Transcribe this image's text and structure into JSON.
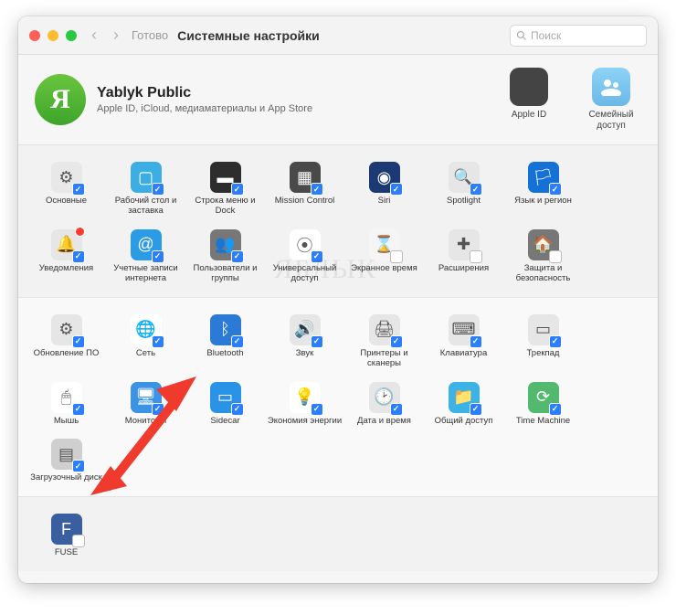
{
  "titlebar": {
    "done": "Готово",
    "title": "Системные настройки",
    "search_placeholder": "Поиск"
  },
  "account": {
    "avatar_letter": "Я",
    "name": "Yablyk Public",
    "subtitle": "Apple ID, iCloud, медиаматериалы и App Store",
    "apple_id": "Apple ID",
    "family": "Семейный доступ"
  },
  "section1": [
    {
      "label": "Основные",
      "icon": "⚙︎",
      "ibg": "#e8e8e8",
      "checked": true
    },
    {
      "label": "Рабочий стол и заставка",
      "icon": "▢",
      "ibg": "#3caee3",
      "checked": true
    },
    {
      "label": "Строка меню и Dock",
      "icon": "▬",
      "ibg": "#2d2d2d",
      "checked": true
    },
    {
      "label": "Mission Control",
      "icon": "▦",
      "ibg": "#4a4a4a",
      "checked": true
    },
    {
      "label": "Siri",
      "icon": "◉",
      "ibg": "#1b3a74",
      "checked": true
    },
    {
      "label": "Spotlight",
      "icon": "🔍",
      "ibg": "#e6e6e6",
      "checked": true
    },
    {
      "label": "Язык и регион",
      "icon": "🏳",
      "ibg": "#1471d6",
      "checked": true
    },
    {
      "label": "Уведомления",
      "icon": "🔔",
      "ibg": "#e6e6e6",
      "checked": true,
      "badge": true
    },
    {
      "label": "Учетные записи интернета",
      "icon": "@",
      "ibg": "#2b9be6",
      "checked": true
    },
    {
      "label": "Пользователи и группы",
      "icon": "👥",
      "ibg": "#777",
      "checked": true
    },
    {
      "label": "Универсальный доступ",
      "icon": "⦿",
      "ibg": "#fff",
      "checked": true
    },
    {
      "label": "Экранное время",
      "icon": "⌛",
      "ibg": "#f5f5f5",
      "checked": false
    },
    {
      "label": "Расширения",
      "icon": "✚",
      "ibg": "#e6e6e6",
      "checked": false
    },
    {
      "label": "Защита и безопасность",
      "icon": "🏠",
      "ibg": "#777",
      "checked": false
    }
  ],
  "section2": [
    {
      "label": "Обновление ПО",
      "icon": "⚙︎",
      "ibg": "#e6e6e6",
      "checked": true
    },
    {
      "label": "Сеть",
      "icon": "🌐",
      "ibg": "#fff",
      "checked": true
    },
    {
      "label": "Bluetooth",
      "icon": "ᛒ",
      "ibg": "#2b7bd6",
      "checked": true
    },
    {
      "label": "Звук",
      "icon": "🔊",
      "ibg": "#e6e6e6",
      "checked": true
    },
    {
      "label": "Принтеры и сканеры",
      "icon": "🖨",
      "ibg": "#e6e6e6",
      "checked": true
    },
    {
      "label": "Клавиатура",
      "icon": "⌨",
      "ibg": "#e6e6e6",
      "checked": true
    },
    {
      "label": "Трекпад",
      "icon": "▭",
      "ibg": "#e6e6e6",
      "checked": true
    },
    {
      "label": "Мышь",
      "icon": "🖱",
      "ibg": "#fff",
      "checked": true
    },
    {
      "label": "Мониторы",
      "icon": "🖥",
      "ibg": "#3b93e6",
      "checked": true
    },
    {
      "label": "Sidecar",
      "icon": "▭",
      "ibg": "#2b93e6",
      "checked": true
    },
    {
      "label": "Экономия энергии",
      "icon": "💡",
      "ibg": "#fff",
      "checked": true
    },
    {
      "label": "Дата и время",
      "icon": "🕑",
      "ibg": "#e6e6e6",
      "checked": true
    },
    {
      "label": "Общий доступ",
      "icon": "📁",
      "ibg": "#3cb3e6",
      "checked": true
    },
    {
      "label": "Time Machine",
      "icon": "⟳",
      "ibg": "#52b96f",
      "checked": true
    },
    {
      "label": "Загрузочный диск",
      "icon": "▤",
      "ibg": "#cfcfcf",
      "checked": true
    }
  ],
  "section3": [
    {
      "label": "FUSE",
      "icon": "F",
      "ibg": "#3a5fa0",
      "checked": false
    }
  ],
  "watermark": "ЯБЛЫК"
}
